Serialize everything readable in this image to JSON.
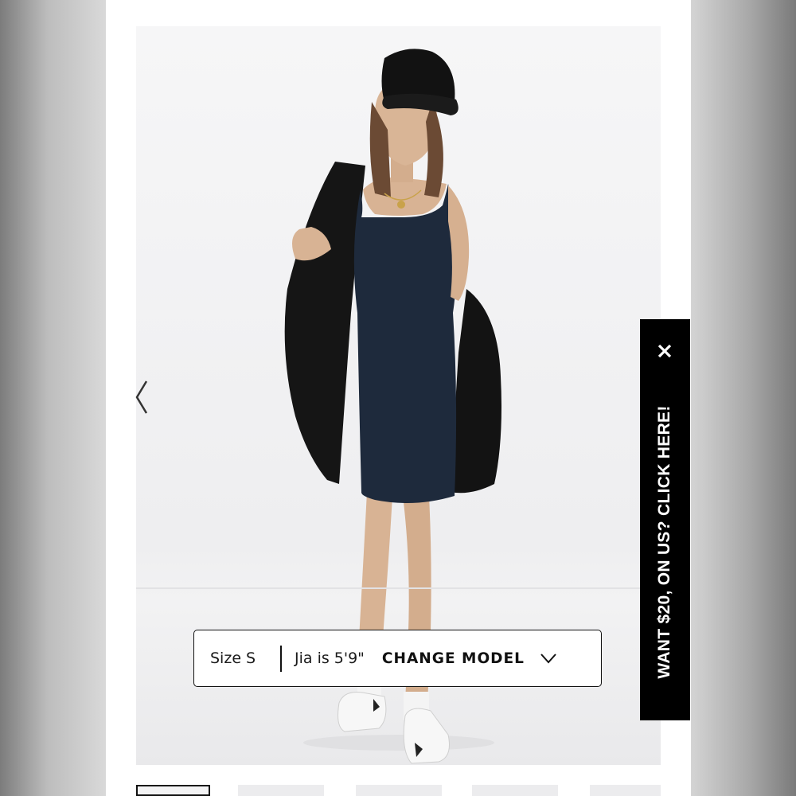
{
  "product_image": {
    "alt_subject": "model-wearing-navy-knit-dress"
  },
  "size_bar": {
    "size_label": "Size S",
    "model_label": "Jia is 5'9\"",
    "change_model_label": "CHANGE MODEL"
  },
  "promo": {
    "text": "WANT $20, ON US? CLICK HERE!",
    "close_icon": "close-icon"
  },
  "thumbnails": {
    "count_visible": 5,
    "active_index": 0
  },
  "colors": {
    "accent": "#000000",
    "dress": "#1e2a3c",
    "jacket": "#151515"
  }
}
